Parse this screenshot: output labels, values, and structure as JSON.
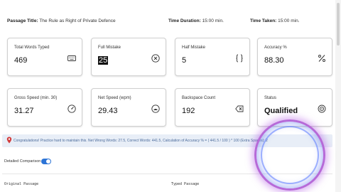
{
  "meta": {
    "passage_title_label": "Passage Title:",
    "passage_title_value": "The Rule as Right of Private Defence",
    "time_duration_label": "Time Duration:",
    "time_duration_value": "15:00 min.",
    "time_taken_label": "Time Taken:",
    "time_taken_value": "15:00 min."
  },
  "stats": [
    {
      "label": "Total Words Typed",
      "value": "469",
      "icon": "keyboard-icon"
    },
    {
      "label": "Full Mistake",
      "value": "25",
      "icon": "x-circle-icon"
    },
    {
      "label": "Half Mistake",
      "value": "5",
      "icon": "braces-icon"
    },
    {
      "label": "Accuracy %",
      "value": "88.30",
      "icon": "percent-icon"
    },
    {
      "label": "Gross Speed (min. 30)",
      "value": "31.27",
      "icon": "speedometer-icon"
    },
    {
      "label": "Net Speed (wpm)",
      "value": "29.43",
      "icon": "gauge-face-icon"
    },
    {
      "label": "Backspace Count",
      "value": "192",
      "icon": "backspace-icon"
    },
    {
      "label": "Status",
      "value": "Qualified",
      "icon": "target-icon"
    }
  ],
  "banner": {
    "message": "Congratulations! Practice hard to maintain this. Net Wrong Words: 27.5, Correct Words: 441.5, Calculation of Accuracy % = ( 441.5 / 100 ) * 100 (Extra Spaces): 2"
  },
  "detailed_comparison": {
    "label": "Detailed Comparison",
    "enabled": true
  },
  "columns": {
    "original": "Original Passage",
    "typed": "Typed Passage"
  },
  "colors": {
    "accent": "#2d74d6",
    "banner_bg": "#e8eef7",
    "banner_text": "#4a6a9a",
    "pin": "#d23a3a"
  }
}
